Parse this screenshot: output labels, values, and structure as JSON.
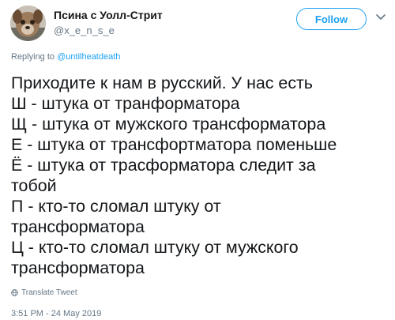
{
  "author": {
    "name": "Псина с Уолл-Стрит",
    "handle": "@x_e_n_s_e",
    "avatar_icon": "avatar-image"
  },
  "follow_button_label": "Follow",
  "caret_icon": "chevron-down-icon",
  "replying": {
    "prefix": "Replying to",
    "mention": "@untilheatdeath"
  },
  "tweet_lines": [
    "Приходите к нам в русский. У нас есть",
    "Ш - штука от транформатора",
    "Щ - штука от мужского трансформатора",
    "Е - штука от трансфортматора поменьше",
    "Ё - штука от трасформатора следит за",
    "тобой",
    "П - кто-то сломал штуку от",
    "трансформатора",
    "Ц - кто-то сломал штуку от мужского",
    "трансформатора"
  ],
  "translate_label": "Translate Tweet",
  "translate_icon": "globe-icon",
  "timestamp": "3:51 PM - 24 May 2019",
  "colors": {
    "accent": "#1da1f2",
    "text": "#14171a",
    "muted": "#657786"
  }
}
